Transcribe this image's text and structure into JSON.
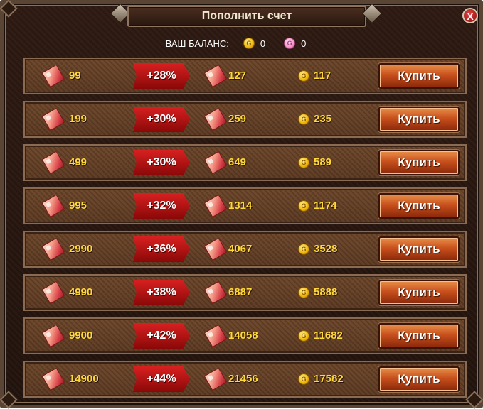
{
  "window": {
    "title": "Пополнить счет",
    "close_label": "X"
  },
  "balance": {
    "label": "ВАШ БАЛАНС:",
    "gold_coin_letter": "G",
    "gold_value": "0",
    "pink_coin_letter": "G",
    "pink_value": "0"
  },
  "colors": {
    "gold_text": "#ffd83a",
    "bonus_red": "#d82020",
    "buy_button_orange": "#c8501c"
  },
  "icons": {
    "crystal": "crystal-icon",
    "coin": "gold-coin-icon"
  },
  "packages": [
    {
      "base": "99",
      "bonus": "+28%",
      "total": "127",
      "coin": "G",
      "price": "117",
      "buy_label": "Купить"
    },
    {
      "base": "199",
      "bonus": "+30%",
      "total": "259",
      "coin": "G",
      "price": "235",
      "buy_label": "Купить"
    },
    {
      "base": "499",
      "bonus": "+30%",
      "total": "649",
      "coin": "G",
      "price": "589",
      "buy_label": "Купить"
    },
    {
      "base": "995",
      "bonus": "+32%",
      "total": "1314",
      "coin": "G",
      "price": "1174",
      "buy_label": "Купить"
    },
    {
      "base": "2990",
      "bonus": "+36%",
      "total": "4067",
      "coin": "G",
      "price": "3528",
      "buy_label": "Купить"
    },
    {
      "base": "4990",
      "bonus": "+38%",
      "total": "6887",
      "coin": "G",
      "price": "5888",
      "buy_label": "Купить"
    },
    {
      "base": "9900",
      "bonus": "+42%",
      "total": "14058",
      "coin": "G",
      "price": "11682",
      "buy_label": "Купить"
    },
    {
      "base": "14900",
      "bonus": "+44%",
      "total": "21456",
      "coin": "G",
      "price": "17582",
      "buy_label": "Купить"
    }
  ]
}
